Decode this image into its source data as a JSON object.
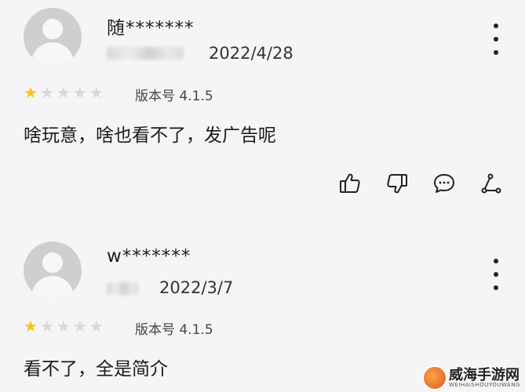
{
  "reviews": [
    {
      "username": "随*******",
      "date": "2022/4/28",
      "rating": 1,
      "max_rating": 5,
      "version": "版本号 4.1.5",
      "content": "啥玩意，啥也看不了，发广告呢"
    },
    {
      "username": "w*******",
      "date": "2022/3/7",
      "rating": 1,
      "max_rating": 5,
      "version": "版本号 4.1.5",
      "content": "看不了，全是简介"
    }
  ],
  "watermark": {
    "name": "威海手游网",
    "sub": "WEIHAISHOUYOUWANG"
  },
  "colors": {
    "star_on": "#f5c518",
    "star_off": "#d8d8d8",
    "background": "#f5f5f7"
  },
  "icons": [
    "thumbs-up-icon",
    "thumbs-down-icon",
    "comment-icon",
    "share-icon",
    "more-vertical-icon",
    "star-icon"
  ]
}
